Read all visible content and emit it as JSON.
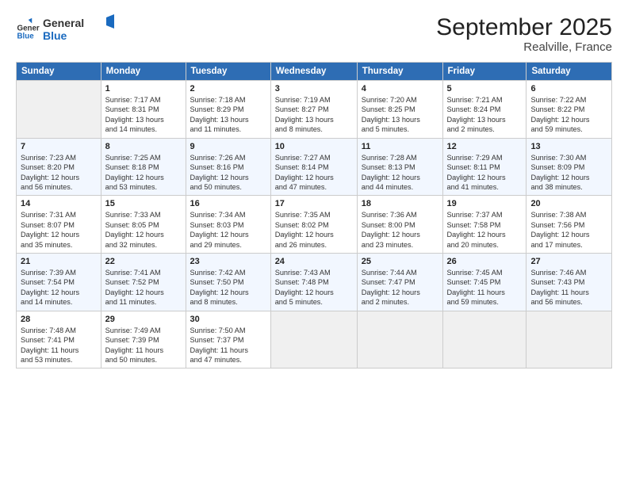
{
  "logo": {
    "general": "General",
    "blue": "Blue"
  },
  "title": "September 2025",
  "subtitle": "Realville, France",
  "weekdays": [
    "Sunday",
    "Monday",
    "Tuesday",
    "Wednesday",
    "Thursday",
    "Friday",
    "Saturday"
  ],
  "weeks": [
    [
      {
        "day": "",
        "info": ""
      },
      {
        "day": "1",
        "info": "Sunrise: 7:17 AM\nSunset: 8:31 PM\nDaylight: 13 hours\nand 14 minutes."
      },
      {
        "day": "2",
        "info": "Sunrise: 7:18 AM\nSunset: 8:29 PM\nDaylight: 13 hours\nand 11 minutes."
      },
      {
        "day": "3",
        "info": "Sunrise: 7:19 AM\nSunset: 8:27 PM\nDaylight: 13 hours\nand 8 minutes."
      },
      {
        "day": "4",
        "info": "Sunrise: 7:20 AM\nSunset: 8:25 PM\nDaylight: 13 hours\nand 5 minutes."
      },
      {
        "day": "5",
        "info": "Sunrise: 7:21 AM\nSunset: 8:24 PM\nDaylight: 13 hours\nand 2 minutes."
      },
      {
        "day": "6",
        "info": "Sunrise: 7:22 AM\nSunset: 8:22 PM\nDaylight: 12 hours\nand 59 minutes."
      }
    ],
    [
      {
        "day": "7",
        "info": "Sunrise: 7:23 AM\nSunset: 8:20 PM\nDaylight: 12 hours\nand 56 minutes."
      },
      {
        "day": "8",
        "info": "Sunrise: 7:25 AM\nSunset: 8:18 PM\nDaylight: 12 hours\nand 53 minutes."
      },
      {
        "day": "9",
        "info": "Sunrise: 7:26 AM\nSunset: 8:16 PM\nDaylight: 12 hours\nand 50 minutes."
      },
      {
        "day": "10",
        "info": "Sunrise: 7:27 AM\nSunset: 8:14 PM\nDaylight: 12 hours\nand 47 minutes."
      },
      {
        "day": "11",
        "info": "Sunrise: 7:28 AM\nSunset: 8:13 PM\nDaylight: 12 hours\nand 44 minutes."
      },
      {
        "day": "12",
        "info": "Sunrise: 7:29 AM\nSunset: 8:11 PM\nDaylight: 12 hours\nand 41 minutes."
      },
      {
        "day": "13",
        "info": "Sunrise: 7:30 AM\nSunset: 8:09 PM\nDaylight: 12 hours\nand 38 minutes."
      }
    ],
    [
      {
        "day": "14",
        "info": "Sunrise: 7:31 AM\nSunset: 8:07 PM\nDaylight: 12 hours\nand 35 minutes."
      },
      {
        "day": "15",
        "info": "Sunrise: 7:33 AM\nSunset: 8:05 PM\nDaylight: 12 hours\nand 32 minutes."
      },
      {
        "day": "16",
        "info": "Sunrise: 7:34 AM\nSunset: 8:03 PM\nDaylight: 12 hours\nand 29 minutes."
      },
      {
        "day": "17",
        "info": "Sunrise: 7:35 AM\nSunset: 8:02 PM\nDaylight: 12 hours\nand 26 minutes."
      },
      {
        "day": "18",
        "info": "Sunrise: 7:36 AM\nSunset: 8:00 PM\nDaylight: 12 hours\nand 23 minutes."
      },
      {
        "day": "19",
        "info": "Sunrise: 7:37 AM\nSunset: 7:58 PM\nDaylight: 12 hours\nand 20 minutes."
      },
      {
        "day": "20",
        "info": "Sunrise: 7:38 AM\nSunset: 7:56 PM\nDaylight: 12 hours\nand 17 minutes."
      }
    ],
    [
      {
        "day": "21",
        "info": "Sunrise: 7:39 AM\nSunset: 7:54 PM\nDaylight: 12 hours\nand 14 minutes."
      },
      {
        "day": "22",
        "info": "Sunrise: 7:41 AM\nSunset: 7:52 PM\nDaylight: 12 hours\nand 11 minutes."
      },
      {
        "day": "23",
        "info": "Sunrise: 7:42 AM\nSunset: 7:50 PM\nDaylight: 12 hours\nand 8 minutes."
      },
      {
        "day": "24",
        "info": "Sunrise: 7:43 AM\nSunset: 7:48 PM\nDaylight: 12 hours\nand 5 minutes."
      },
      {
        "day": "25",
        "info": "Sunrise: 7:44 AM\nSunset: 7:47 PM\nDaylight: 12 hours\nand 2 minutes."
      },
      {
        "day": "26",
        "info": "Sunrise: 7:45 AM\nSunset: 7:45 PM\nDaylight: 11 hours\nand 59 minutes."
      },
      {
        "day": "27",
        "info": "Sunrise: 7:46 AM\nSunset: 7:43 PM\nDaylight: 11 hours\nand 56 minutes."
      }
    ],
    [
      {
        "day": "28",
        "info": "Sunrise: 7:48 AM\nSunset: 7:41 PM\nDaylight: 11 hours\nand 53 minutes."
      },
      {
        "day": "29",
        "info": "Sunrise: 7:49 AM\nSunset: 7:39 PM\nDaylight: 11 hours\nand 50 minutes."
      },
      {
        "day": "30",
        "info": "Sunrise: 7:50 AM\nSunset: 7:37 PM\nDaylight: 11 hours\nand 47 minutes."
      },
      {
        "day": "",
        "info": ""
      },
      {
        "day": "",
        "info": ""
      },
      {
        "day": "",
        "info": ""
      },
      {
        "day": "",
        "info": ""
      }
    ]
  ]
}
